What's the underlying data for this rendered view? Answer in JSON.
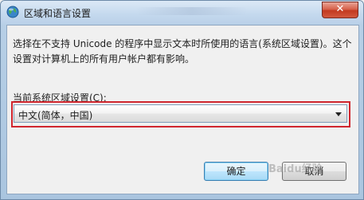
{
  "window": {
    "title": "区域和语言设置",
    "close_label": "✕",
    "icon": "globe-icon"
  },
  "main": {
    "description": "选择在不支持 Unicode 的程序中显示文本时所使用的语言(系统区域设置)。这个设置对计算机上的所有用户帐户都有影响。",
    "current_label": "当前系统区域设置(C):",
    "current_value": "中文(简体，中国)"
  },
  "buttons": {
    "ok": "确定",
    "cancel": "取消"
  },
  "watermark": "Baidu经验",
  "colors": {
    "highlight": "#d0262e",
    "close": "#c23a20"
  }
}
